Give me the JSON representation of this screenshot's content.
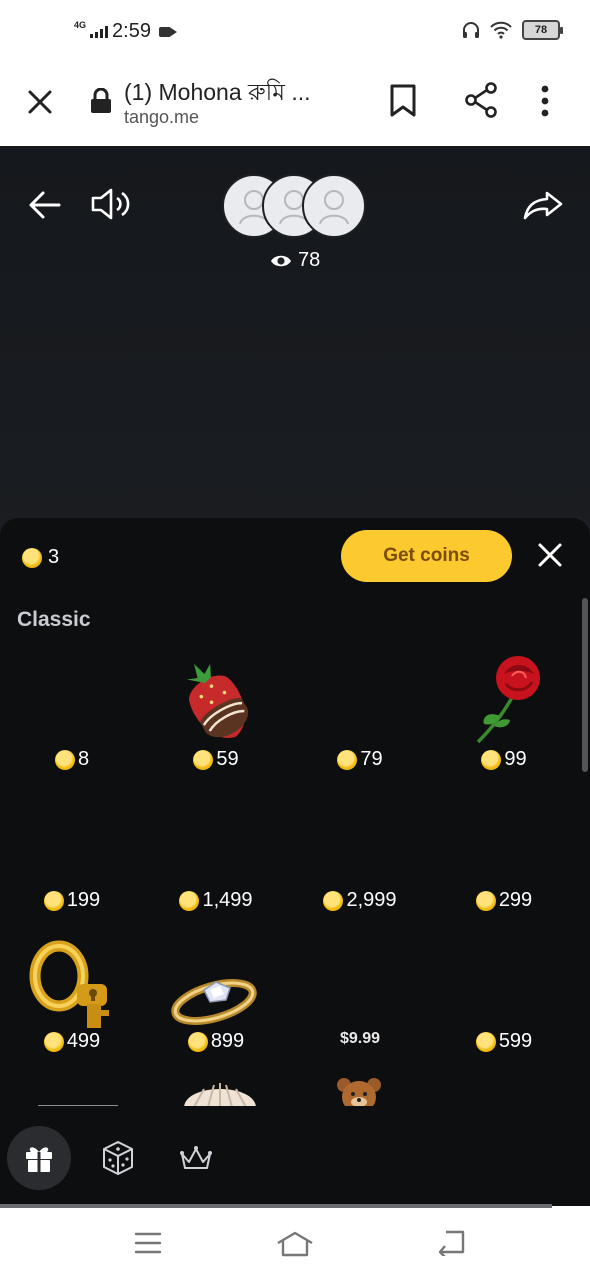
{
  "status_bar": {
    "network": "4G",
    "time": "2:59",
    "battery": "78"
  },
  "browser": {
    "title": "(1) Mohona রুমি ...",
    "url": "tango.me"
  },
  "stream": {
    "viewer_count": "78"
  },
  "gift_panel": {
    "coin_balance": "3",
    "get_coins_label": "Get coins",
    "section_title": "Classic",
    "gifts": [
      {
        "price": "8",
        "icon": "empty"
      },
      {
        "price": "59",
        "icon": "chocolate-strawberry"
      },
      {
        "price": "79",
        "icon": "empty"
      },
      {
        "price": "99",
        "icon": "red-rose"
      },
      {
        "price": "199",
        "icon": "empty"
      },
      {
        "price": "1,499",
        "icon": "empty"
      },
      {
        "price": "2,999",
        "icon": "empty"
      },
      {
        "price": "299",
        "icon": "empty"
      },
      {
        "price": "499",
        "icon": "golden-key"
      },
      {
        "price": "899",
        "icon": "diamond-ring"
      },
      {
        "price": "$9.99",
        "icon": "empty",
        "currency": "usd"
      },
      {
        "price": "599",
        "icon": "empty"
      }
    ],
    "tabs": [
      "gift-icon",
      "dice-icon",
      "crown-icon"
    ]
  },
  "colors": {
    "accent": "#fcca2e",
    "panel_bg": "#0d0e10",
    "stream_bg": "#1d2024"
  }
}
